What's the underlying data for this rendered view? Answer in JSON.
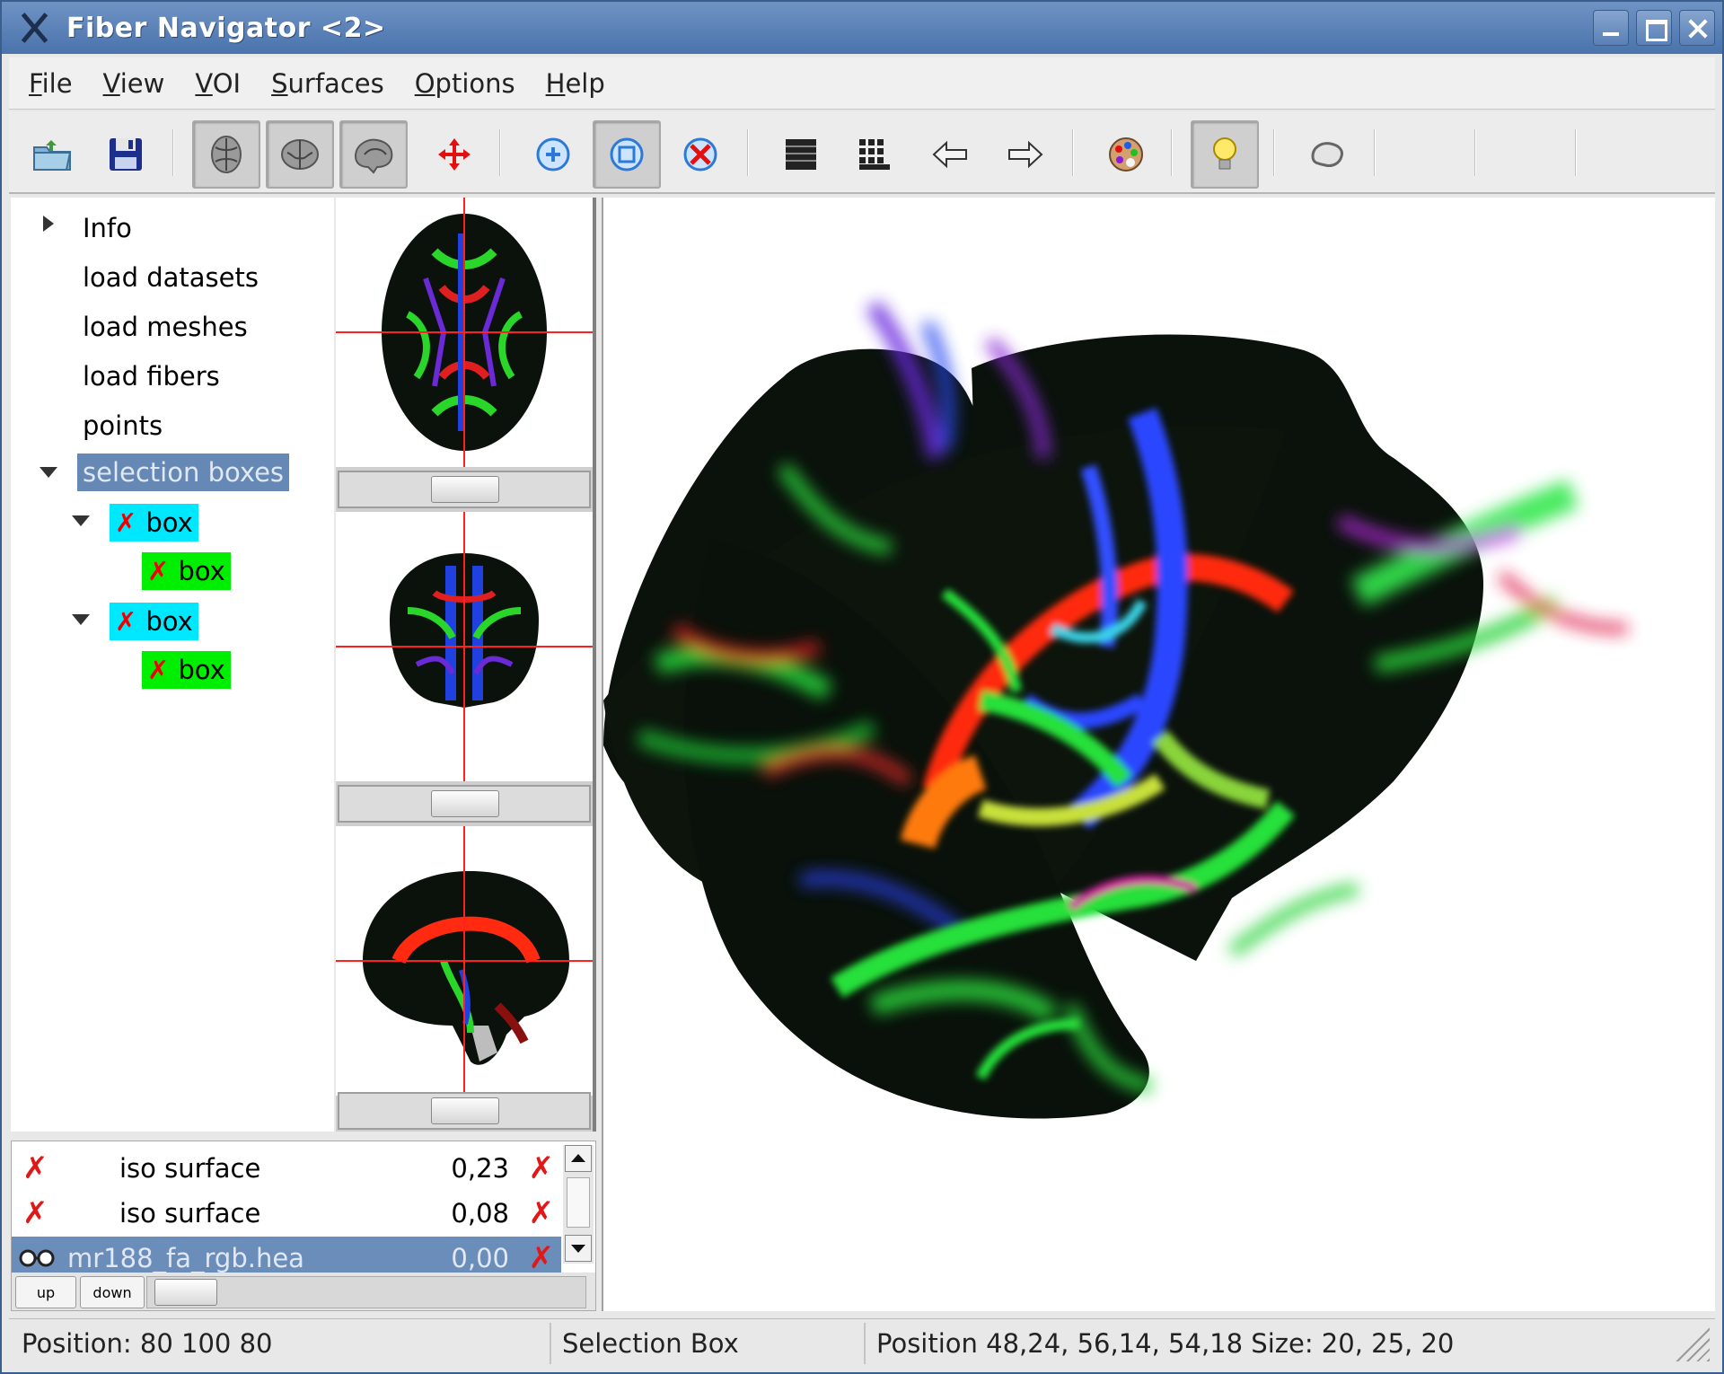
{
  "window": {
    "title": "Fiber Navigator <2>"
  },
  "menu": [
    "File",
    "View",
    "VOI",
    "Surfaces",
    "Options",
    "Help"
  ],
  "toolbar": {
    "buttons": [
      "open-folder-icon",
      "save-icon",
      "axial-view-icon",
      "coronal-view-icon",
      "sagittal-view-icon",
      "crosshair-move-icon",
      "new-box-icon",
      "show-boxes-icon",
      "delete-box-icon",
      "grid-icon",
      "fibers-grid-icon",
      "arrow-left-icon",
      "arrow-right-icon",
      "color-palette-icon",
      "lighting-bulb-icon",
      "surface-icon"
    ]
  },
  "tree": {
    "items": [
      {
        "label": "Info"
      },
      {
        "label": "load datasets"
      },
      {
        "label": "load meshes"
      },
      {
        "label": "load fibers"
      },
      {
        "label": "points"
      },
      {
        "label": "selection boxes"
      },
      {
        "label": "box"
      },
      {
        "label": "box"
      },
      {
        "label": "box"
      },
      {
        "label": "box"
      }
    ],
    "xmark": "✗"
  },
  "datasets": {
    "rows": [
      {
        "name": "iso surface",
        "value": "0,23"
      },
      {
        "name": "iso surface",
        "value": "0,08"
      },
      {
        "name": "mr188_fa_rgb.hea",
        "value": "0,00"
      }
    ],
    "up_label": "up",
    "down_label": "down"
  },
  "status": {
    "position": "Position: 80  100  80",
    "mode": "Selection Box",
    "box_info": "Position 48,24, 56,14, 54,18  Size: 20, 25, 20"
  },
  "colors": {
    "title_bar": "#4a73ac",
    "selection": "#6688b4",
    "box_cyan": "#00e8ff",
    "box_green": "#00ee00",
    "delete_red": "#e21818"
  }
}
